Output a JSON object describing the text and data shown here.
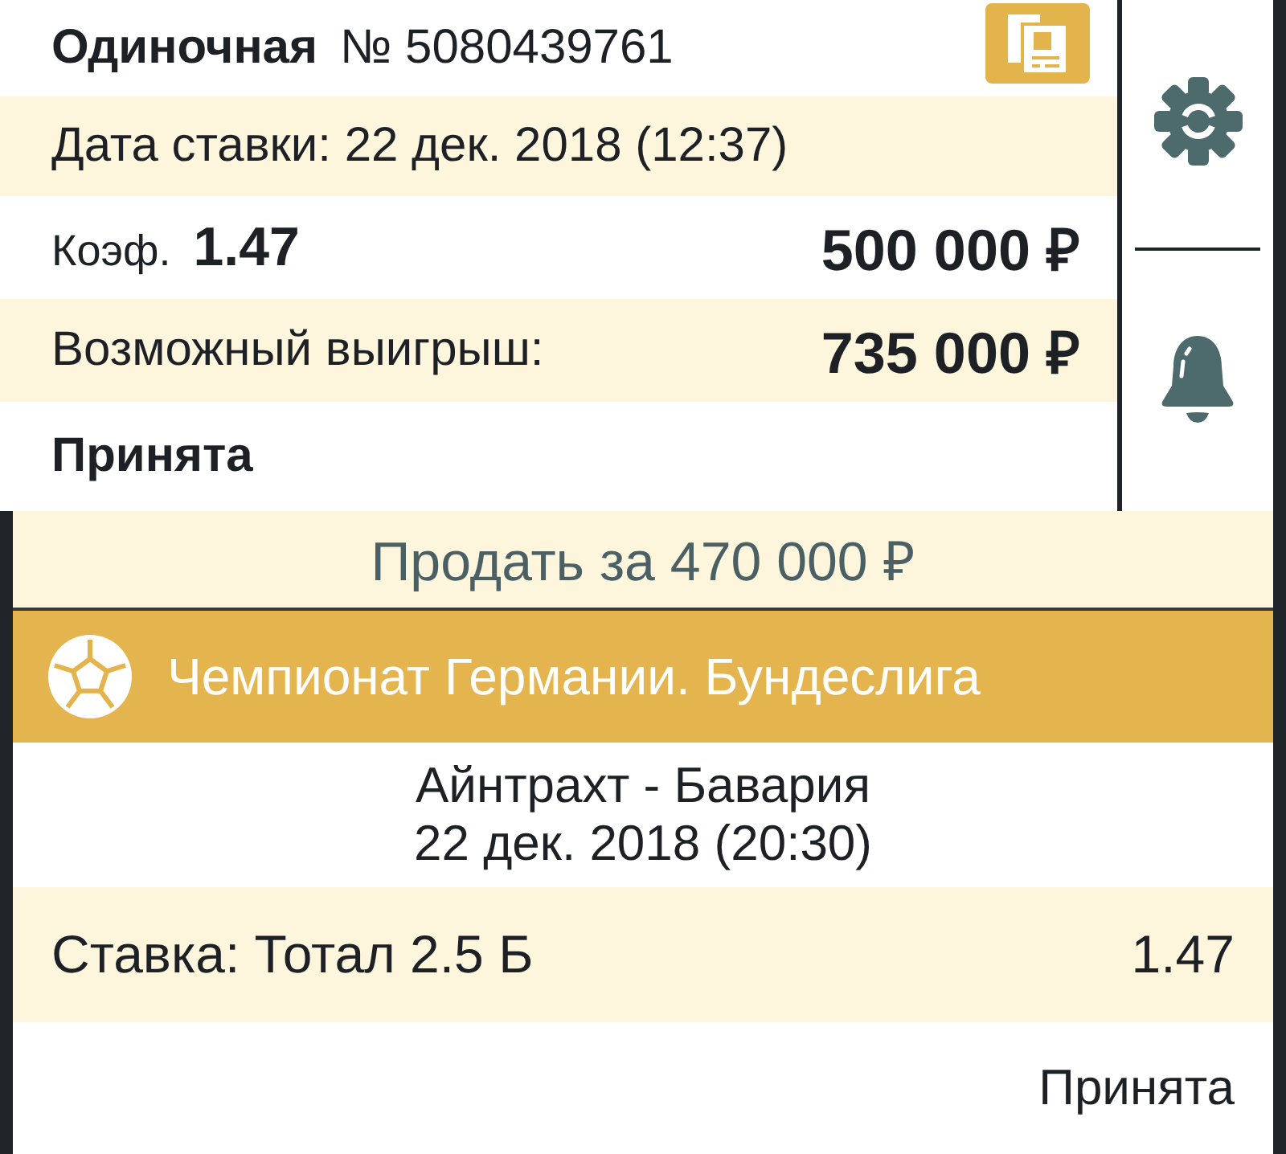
{
  "bet": {
    "type": "Одиночная",
    "number": "№ 5080439761",
    "date": "Дата ставки: 22 дек. 2018 (12:37)",
    "odds_label": "Коэф.",
    "odds": "1.47",
    "stake": "500 000 ₽",
    "win_label": "Возможный выигрыш:",
    "win": "735 000 ₽",
    "status": "Принята"
  },
  "sell_button": {
    "label": "Продать за 470 000 ₽"
  },
  "events": [
    {
      "league": "Чемпионат Германии. Бундеслига",
      "match": "Айнтрахт - Бавария",
      "datetime": "22 дек. 2018 (20:30)",
      "selection": "Ставка: Тотал 2.5 Б",
      "odds": "1.47",
      "status": "Принята"
    }
  ]
}
